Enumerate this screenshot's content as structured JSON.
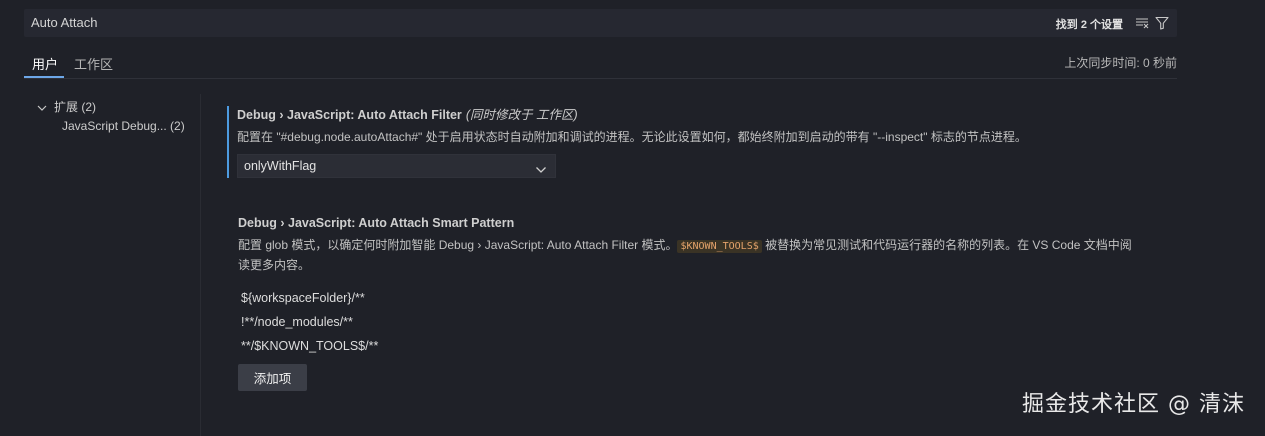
{
  "search": {
    "value": "Auto Attach",
    "result_count": "找到 2 个设置"
  },
  "tabs": {
    "user": "用户",
    "workspace": "工作区"
  },
  "sync_status": "上次同步时间: 0 秒前",
  "toc": {
    "group_label": "扩展 (2)",
    "item_label": "JavaScript Debug... (2)"
  },
  "settings": {
    "auto_attach_filter": {
      "category": "Debug › JavaScript: ",
      "name": "Auto Attach Filter",
      "modified_note": "(同时修改于 工作区)",
      "description": "配置在 \"#debug.node.autoAttach#\" 处于启用状态时自动附加和调试的进程。无论此设置如何，都始终附加到启动的带有 \"--inspect\" 标志的节点进程。",
      "selected_value": "onlyWithFlag"
    },
    "smart_pattern": {
      "category": "Debug › JavaScript: ",
      "name": "Auto Attach Smart Pattern",
      "description_before": "配置 glob 模式，以确定何时附加智能 Debug › JavaScript: Auto Attach Filter 模式。",
      "code_token": "$KNOWN_TOOLS$",
      "description_after": " 被替换为常见测试和代码运行器的名称的列表。在 VS Code 文档中阅读更多内容。",
      "patterns": [
        "${workspaceFolder}/**",
        "!**/node_modules/**",
        "**/$KNOWN_TOOLS$/**"
      ],
      "add_button": "添加项"
    }
  },
  "watermark": "掘金技术社区 @ 清沫",
  "colors": {
    "background": "#1f2128",
    "accent": "#4d9be0",
    "code_token": "#e5a36b"
  },
  "icons": {
    "clear": "clear-filter-icon",
    "filter": "filter-icon",
    "toc_chevron": "chevron-down-icon",
    "select_chevron": "chevron-down-icon"
  }
}
